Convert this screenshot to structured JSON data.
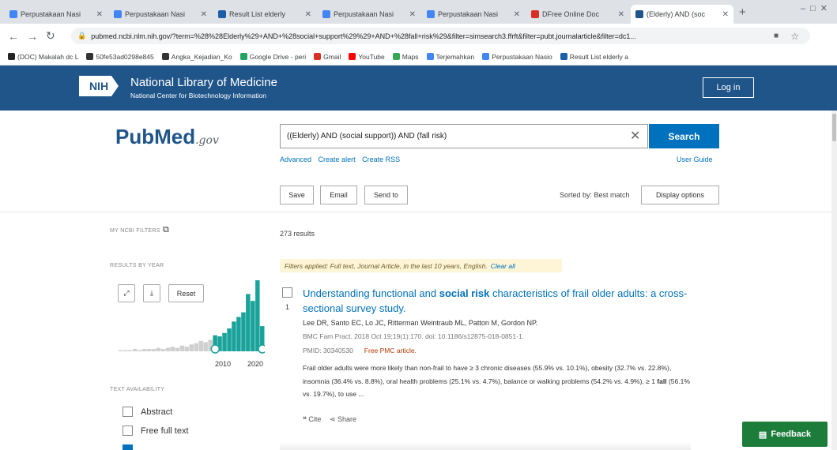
{
  "browser": {
    "tabs": [
      {
        "label": "Perpustakaan Nasi",
        "icon_color": "#4285f4"
      },
      {
        "label": "Perpustakaan Nasi",
        "icon_color": "#4285f4"
      },
      {
        "label": "Result List elderly",
        "icon_color": "#1a5fa8"
      },
      {
        "label": "Perpustakaan Nasi",
        "icon_color": "#4285f4"
      },
      {
        "label": "Perpustakaan Nasi",
        "icon_color": "#4285f4"
      },
      {
        "label": "DFree Online Doc",
        "icon_color": "#d93025"
      },
      {
        "label": "(Elderly) AND (soc",
        "icon_color": "#20558a"
      }
    ],
    "url": "pubmed.ncbi.nlm.nih.gov/?term=%28%28Elderly%29+AND+%28social+support%29%29+AND+%28fall+risk%29&filter=simsearch3.ffrft&filter=pubt.journalarticle&filter=dc1...",
    "bookmarks": [
      {
        "label": "(DOC) Makalah dc L",
        "color": "#222"
      },
      {
        "label": "50fe53ad0298e845",
        "color": "#333"
      },
      {
        "label": "Angka_Kejadian_Ko",
        "color": "#333"
      },
      {
        "label": "Google Drive - peri",
        "color": "#1fa463"
      },
      {
        "label": "Gmail",
        "color": "#d93025"
      },
      {
        "label": "YouTube",
        "color": "#ff0000"
      },
      {
        "label": "Maps",
        "color": "#34a853"
      },
      {
        "label": "Terjemahkan",
        "color": "#4285f4"
      },
      {
        "label": "Perpustakaan Nasio",
        "color": "#4285f4"
      },
      {
        "label": "Result List elderly a",
        "color": "#1a5fa8"
      }
    ]
  },
  "header": {
    "nih_logo": "NIH",
    "title": "National Library of Medicine",
    "subtitle": "National Center for Biotechnology Information",
    "login": "Log in"
  },
  "search": {
    "logo_main": "PubMed",
    "logo_suffix": ".gov",
    "query": "((Elderly) AND (social support)) AND (fall risk)",
    "button": "Search",
    "links": [
      "Advanced",
      "Create alert",
      "Create RSS"
    ],
    "user_guide": "User Guide"
  },
  "toolbar": {
    "save": "Save",
    "email": "Email",
    "send_to": "Send to",
    "sorted_by": "Sorted by: Best match",
    "display_options": "Display options"
  },
  "sidebar": {
    "my_ncbi_filters": "MY NCBI FILTERS",
    "results_by_year": "RESULTS BY YEAR",
    "reset": "Reset",
    "year_start": "2010",
    "year_end": "2020",
    "text_availability": "TEXT AVAILABILITY",
    "checkboxes": [
      "Abstract",
      "Free full text"
    ],
    "histogram": [
      1,
      1,
      1,
      2,
      1,
      2,
      2,
      2,
      3,
      2,
      3,
      4,
      3,
      5,
      4,
      6,
      7,
      9,
      8,
      10,
      14,
      13,
      16,
      20,
      26,
      30,
      34,
      50,
      44,
      62,
      22
    ]
  },
  "results": {
    "count": "273 results",
    "filters_applied": "Filters applied: Full text, Journal Article, in the last 10 years, English.",
    "clear_all": "Clear all",
    "items": [
      {
        "number": "1",
        "title_pre": "Understanding functional and ",
        "title_bold": "social risk",
        "title_post": " characteristics of frail older adults: a cross-sectional survey study.",
        "authors": "Lee DR, Santo EC, Lo JC, Ritterman Weintraub ML, Patton M, Gordon NP.",
        "citation": "BMC Fam Pract. 2018 Oct 19;19(1):170. doi: 10.1186/s12875-018-0851-1.",
        "pmid": "PMID: 30340530",
        "free": "Free PMC article.",
        "snippet_pre": "Frail older adults were more likely than non-frail to have ≥ 3 chronic diseases (55.9% vs. 10.1%), obesity (32.7% vs. 22.8%), insomnia (36.4% vs. 8.8%), oral health problems (25.1% vs. 4.7%), balance or walking problems (54.2% vs. 4.9%), ≥ 1 ",
        "snippet_bold": "fall",
        "snippet_post": " (56.1% vs. 19.7%), to use ...",
        "cite": "Cite",
        "share": "Share"
      }
    ]
  },
  "feedback": "Feedback"
}
